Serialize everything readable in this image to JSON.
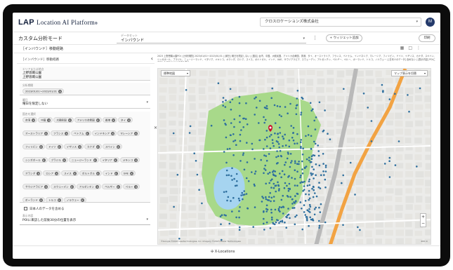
{
  "app": {
    "logo_text": "LAP",
    "logo_sub": "Location AI Platform",
    "company": "クロスロケーションズ株式会社",
    "avatar_initial": "M"
  },
  "subbar": {
    "mode_title": "カスタム分析モード",
    "dataset_label": "データセット",
    "dataset_value": "インバウンド",
    "add_widget": "+ ウィジェット追加",
    "print": "印刷"
  },
  "widget_tab": {
    "title": "［インバウンド］移動経路"
  },
  "left_panel": {
    "header": "［インバウンド］移動経路",
    "fields": [
      {
        "label": "エリアまたは地点",
        "line1": "上野恩賜公園",
        "line2": "上野恩賜公園"
      },
      {
        "label": "分析期間",
        "chip": "2023/01/01〜2023/01/31"
      },
      {
        "label": "曜日",
        "value": "曜日を限定しない"
      }
    ],
    "countries_label": "国名を選択",
    "countries": [
      "台湾",
      "中国",
      "大韓民国",
      "アメリカ合衆国",
      "香港",
      "タイ",
      "オーストラリア",
      "フランス",
      "ベトナム",
      "インドネシア",
      "マレーシア",
      "フィリピン",
      "ドイツ",
      "イギリス",
      "カナダ",
      "スペイン",
      "シンガポール",
      "ブラジル",
      "ニュージーランド",
      "イタリア",
      "メキシコ",
      "オランダ",
      "ロシア",
      "スイス",
      "ポルトガル",
      "インド",
      "UAE",
      "サウジアラビア",
      "スウェーデン",
      "アルゼンチン",
      "ベルギー",
      "ペルー",
      "ポーランド",
      "トルコ",
      "ノルウェー"
    ],
    "japanese_checkbox": "日本人のデータを含める",
    "display_label": "表示内容",
    "display_value": "POIに来訪した前後30分の位置を表示"
  },
  "map": {
    "note": "2023 上野恩賜公園POI | [分析期間] 2023/01/01〜2023/01/31 | [曜日] 曜日を限定しない | [国名] 台湾、中国、大韓民国、アメリカ合衆国、香港、タイ、オーストラリア、フランス、ベトナム、インドネシア、マレーシア、フィリピン、ドイツ、イギリス、カナダ、スペイン、シンガポール、ブラジル、ニュージーランド、イタリア、メキシコ、オランダ、ロシア、スイス、ポルトガル、インド、UAE、サウジアラビア、スウェーデン、アルゼンチン、ベルギー、ペルー、ポーランド、トルコ、ノルウェー | [日本人のデータ] 含めない | [表示内容] POIに来訪した前後30分の位置を表示",
    "map_type": "標準地図",
    "layer_button": "マップ表示を切替",
    "attribution": "©Google ©2023 Geotechnologies, Inc. Imagery ©2023 Maxar Technologies",
    "scale": "200 m"
  },
  "footer": {
    "text": "X-Locations"
  },
  "colors": {
    "dot": "#2e6f9e",
    "park": "#a8d98a",
    "water": "#a6d4f0",
    "road": "#f2a343",
    "rail": "#b9b9b9"
  }
}
